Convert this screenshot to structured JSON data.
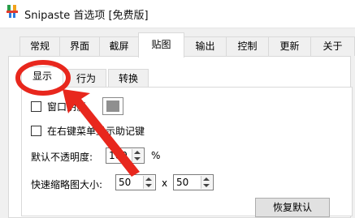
{
  "window": {
    "title": "Snipaste 首选项 [免费版]"
  },
  "tabs": [
    "常规",
    "界面",
    "截屏",
    "贴图",
    "输出",
    "控制",
    "更新",
    "关于"
  ],
  "active_tab": "贴图",
  "subtabs": [
    "显示",
    "行为",
    "转换"
  ],
  "active_subtab": "显示",
  "options": {
    "window_shadow_label": "窗口阴影",
    "window_shadow_checked": false,
    "shadow_color": "#8f8f8f",
    "show_mnemonic_label": "在右键菜单显示助记键",
    "show_mnemonic_checked": false,
    "default_opacity_label": "默认不透明度:",
    "default_opacity_value": "100",
    "default_opacity_unit": "%",
    "thumbnail_size_label": "快速缩略图大小:",
    "thumbnail_width": "50",
    "thumbnail_separator": "x",
    "thumbnail_height": "50"
  },
  "restore_defaults_label": "恢复默认",
  "annotation_color": "#e8271d"
}
